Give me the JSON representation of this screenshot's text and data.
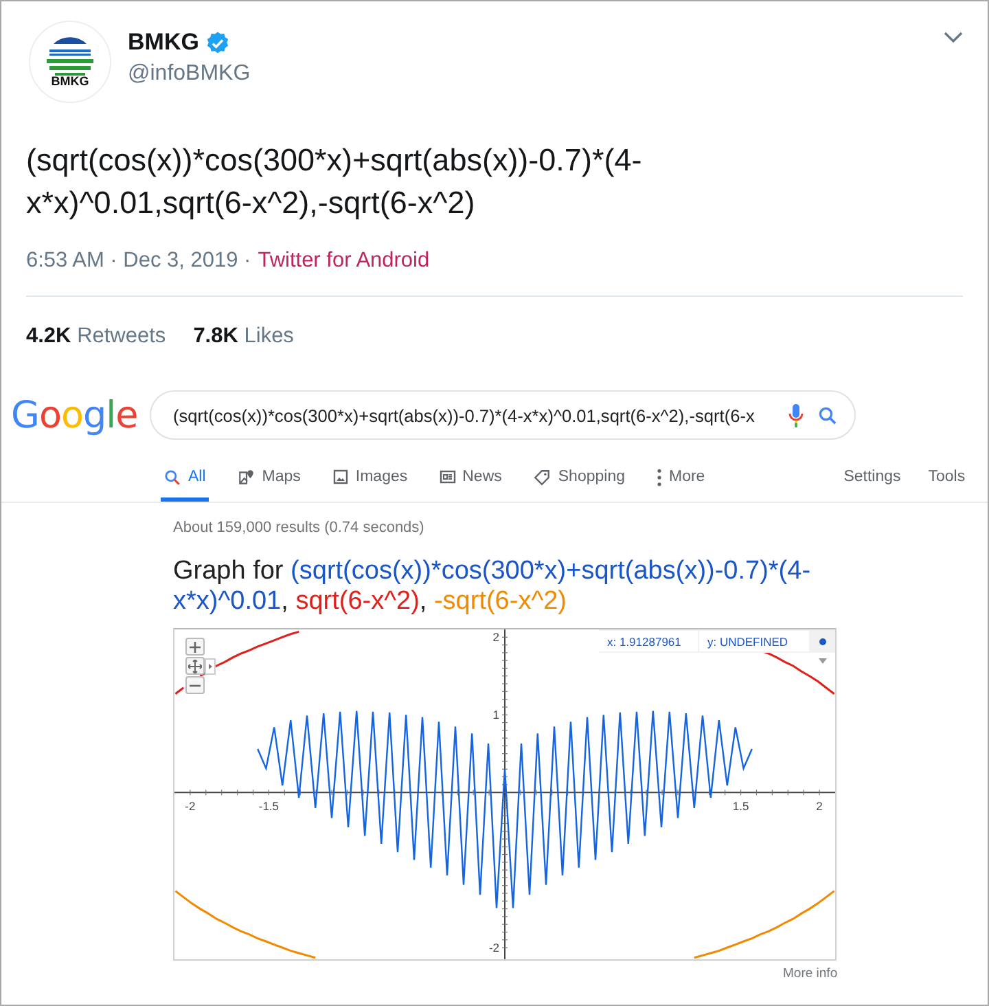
{
  "tweet": {
    "avatar_label": "BMKG",
    "name": "BMKG",
    "verified": true,
    "handle": "@infoBMKG",
    "text": "(sqrt(cos(x))*cos(300*x)+sqrt(abs(x))-0.7)*(4-x*x)^0.01,sqrt(6-x^2),-sqrt(6-x^2)",
    "time": "6:53 AM · Dec 3, 2019 ·",
    "source": "Twitter for Android",
    "stats": [
      {
        "count": "4.2K",
        "label": "Retweets"
      },
      {
        "count": "7.8K",
        "label": "Likes"
      }
    ]
  },
  "google": {
    "logo": "Google",
    "query": "(sqrt(cos(x))*cos(300*x)+sqrt(abs(x))-0.7)*(4-x*x)^0.01,sqrt(6-x^2),-sqrt(6-x",
    "tabs": [
      {
        "label": "All",
        "selected": true
      },
      {
        "label": "Maps",
        "selected": false
      },
      {
        "label": "Images",
        "selected": false
      },
      {
        "label": "News",
        "selected": false
      },
      {
        "label": "Shopping",
        "selected": false
      },
      {
        "label": "More",
        "selected": false
      }
    ],
    "tools": [
      "Settings",
      "Tools"
    ],
    "result_stats": "About 159,000 results (0.74 seconds)",
    "graph_title": [
      {
        "text": "Graph for ",
        "color": "#222222"
      },
      {
        "text": "(sqrt(cos(x))*cos(300*x)+sqrt(abs(x))-0.7)*(4-x*x)^0.01",
        "color": "#1a56c8"
      },
      {
        "text": ", ",
        "color": "#222222"
      },
      {
        "text": "sqrt(6-x^2)",
        "color": "#e0201b"
      },
      {
        "text": ", ",
        "color": "#222222"
      },
      {
        "text": "-sqrt(6-x^2)",
        "color": "#f08a00"
      }
    ],
    "graph": {
      "readout_x": "x: 1.91287961",
      "readout_y": "y: UNDEFINED",
      "chart_data": {
        "type": "line",
        "xlim": [
          -2.1,
          2.1
        ],
        "ylim": [
          -2.15,
          2.1
        ],
        "xticks": [
          -2,
          -1.5,
          1.5,
          2
        ],
        "yticks": [
          -2,
          1,
          2
        ],
        "x": [
          -2.094,
          -2.042,
          -1.99,
          -1.937,
          -1.885,
          -1.833,
          -1.78,
          -1.728,
          -1.676,
          -1.623,
          -1.571,
          -1.518,
          -1.466,
          -1.414,
          -1.361,
          -1.309,
          -1.257,
          -1.204,
          -1.152,
          -1.1,
          -1.047,
          -0.995,
          -0.942,
          -0.89,
          -0.838,
          -0.785,
          -0.733,
          -0.681,
          -0.628,
          -0.576,
          -0.524,
          -0.471,
          -0.419,
          -0.367,
          -0.314,
          -0.262,
          -0.209,
          -0.157,
          -0.105,
          -0.052,
          0,
          0.052,
          0.105,
          0.157,
          0.209,
          0.262,
          0.314,
          0.367,
          0.419,
          0.471,
          0.524,
          0.576,
          0.628,
          0.681,
          0.733,
          0.785,
          0.838,
          0.89,
          0.942,
          0.995,
          1.047,
          1.1,
          1.152,
          1.204,
          1.257,
          1.309,
          1.361,
          1.414,
          1.466,
          1.518,
          1.571,
          1.623,
          1.676,
          1.728,
          1.78,
          1.833,
          1.885,
          1.937,
          1.99,
          2.042,
          2.094
        ],
        "series": [
          {
            "color": "#1565e0",
            "values": [
              null,
              null,
              null,
              null,
              null,
              null,
              null,
              null,
              null,
              null,
              0.56,
              0.31,
              0.84,
              0.09,
              0.93,
              -0.07,
              0.99,
              -0.2,
              1.02,
              -0.33,
              1.04,
              -0.45,
              1.05,
              -0.56,
              1.04,
              -0.66,
              1.03,
              -0.77,
              1.0,
              -0.87,
              0.97,
              -0.97,
              0.91,
              -1.07,
              0.85,
              -1.19,
              0.76,
              -1.32,
              0.63,
              -1.49,
              0.3,
              -1.49,
              0.63,
              -1.32,
              0.76,
              -1.19,
              0.85,
              -1.07,
              0.91,
              -0.97,
              0.97,
              -0.87,
              1.0,
              -0.77,
              1.03,
              -0.66,
              1.04,
              -0.56,
              1.05,
              -0.45,
              1.04,
              -0.33,
              1.02,
              -0.2,
              0.99,
              -0.07,
              0.93,
              0.09,
              0.84,
              0.31,
              0.56,
              null,
              null,
              null,
              null,
              null,
              null,
              null,
              null,
              null,
              null
            ]
          },
          {
            "color": "#e0201b",
            "values": [
              1.27,
              1.35,
              null,
              1.5,
              1.56,
              1.63,
              1.68,
              1.74,
              1.79,
              1.83,
              1.88,
              1.92,
              1.96,
              2.0,
              2.04,
              2.07,
              null,
              null,
              null,
              null,
              null,
              null,
              null,
              null,
              null,
              null,
              null,
              null,
              null,
              null,
              null,
              null,
              null,
              null,
              null,
              null,
              null,
              null,
              null,
              null,
              null,
              null,
              null,
              null,
              null,
              null,
              null,
              null,
              null,
              null,
              null,
              null,
              null,
              null,
              null,
              null,
              null,
              null,
              null,
              null,
              null,
              null,
              null,
              null,
              null,
              null,
              null,
              null,
              null,
              null,
              null,
              1.83,
              1.79,
              1.74,
              1.68,
              1.63,
              1.56,
              1.5,
              1.43,
              1.35,
              1.27
            ]
          },
          {
            "color": "#f08a00",
            "values": [
              -1.27,
              -1.35,
              -1.43,
              -1.5,
              -1.56,
              -1.63,
              -1.68,
              -1.74,
              -1.79,
              -1.83,
              -1.88,
              -1.92,
              -1.96,
              -2.0,
              -2.04,
              -2.07,
              -2.1,
              -2.13,
              null,
              null,
              null,
              null,
              null,
              null,
              null,
              null,
              null,
              null,
              null,
              null,
              null,
              null,
              null,
              null,
              null,
              null,
              null,
              null,
              null,
              null,
              null,
              null,
              null,
              null,
              null,
              null,
              null,
              null,
              null,
              null,
              null,
              null,
              null,
              null,
              null,
              null,
              null,
              null,
              null,
              null,
              null,
              null,
              null,
              -2.13,
              -2.1,
              -2.07,
              -2.04,
              -2.0,
              -1.96,
              -1.92,
              -1.88,
              -1.83,
              -1.79,
              -1.74,
              -1.68,
              -1.63,
              -1.56,
              -1.5,
              -1.43,
              -1.35,
              -1.27
            ]
          }
        ]
      }
    },
    "more_info": "More info"
  }
}
